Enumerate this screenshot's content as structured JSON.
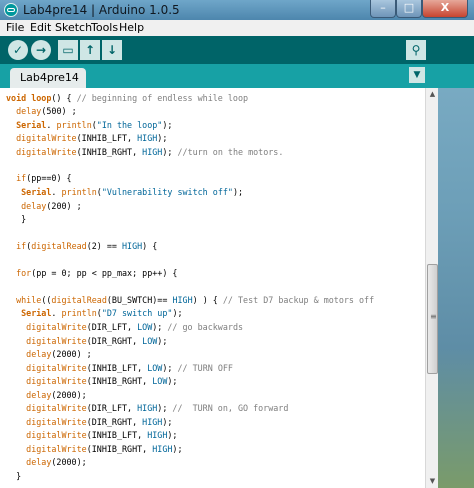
{
  "window": {
    "title": "Lab4pre14 | Arduino 1.0.5",
    "minimize_label": "–",
    "maximize_label": "□",
    "close_label": "X"
  },
  "menu": [
    "File",
    "Edit",
    "Sketch",
    "Tools",
    "Help"
  ],
  "toolbar": {
    "verify_icon": "✓",
    "upload_icon": "→",
    "new_icon": "▭",
    "open_icon": "↑",
    "save_icon": "↓",
    "serial_monitor_icon": "⚲"
  },
  "tab": {
    "label": "Lab4pre14",
    "menu_icon": "▼"
  },
  "scrollbar": {
    "up": "▲",
    "down": "▼",
    "grip": "≡"
  },
  "code": [
    [
      [
        "kwb",
        "void "
      ],
      [
        "kwb",
        "loop"
      ],
      [
        "",
        "() { "
      ],
      [
        "cmt",
        "// beginning of endless while loop"
      ]
    ],
    [
      [
        "",
        "  "
      ],
      [
        "kw",
        "delay"
      ],
      [
        "",
        "(500) ;"
      ]
    ],
    [
      [
        "",
        "  "
      ],
      [
        "kwb",
        "Serial"
      ],
      [
        "",
        ". "
      ],
      [
        "kw",
        "println"
      ],
      [
        "",
        "("
      ],
      [
        "str",
        "\"In the loop\""
      ],
      [
        "",
        ");"
      ]
    ],
    [
      [
        "",
        "  "
      ],
      [
        "kw",
        "digitalWrite"
      ],
      [
        "",
        "(INHIB_LFT, "
      ],
      [
        "lit",
        "HIGH"
      ],
      [
        "",
        ");"
      ]
    ],
    [
      [
        "",
        "  "
      ],
      [
        "kw",
        "digitalWrite"
      ],
      [
        "",
        "(INHIB_RGHT, "
      ],
      [
        "lit",
        "HIGH"
      ],
      [
        "",
        "); "
      ],
      [
        "cmt",
        "//turn on the motors."
      ]
    ],
    [
      [
        "",
        ""
      ]
    ],
    [
      [
        "",
        "  "
      ],
      [
        "kw",
        "if"
      ],
      [
        "",
        "(pp==0) {"
      ]
    ],
    [
      [
        "",
        "   "
      ],
      [
        "kwb",
        "Serial"
      ],
      [
        "",
        ". "
      ],
      [
        "kw",
        "println"
      ],
      [
        "",
        "("
      ],
      [
        "str",
        "\"Vulnerability switch off\""
      ],
      [
        "",
        ");"
      ]
    ],
    [
      [
        "",
        "   "
      ],
      [
        "kw",
        "delay"
      ],
      [
        "",
        "(200) ;"
      ]
    ],
    [
      [
        "",
        "   }"
      ]
    ],
    [
      [
        "",
        ""
      ]
    ],
    [
      [
        "",
        "  "
      ],
      [
        "kw",
        "if"
      ],
      [
        "",
        "("
      ],
      [
        "kw",
        "digitalRead"
      ],
      [
        "",
        "(2) == "
      ],
      [
        "lit",
        "HIGH"
      ],
      [
        "",
        ") {"
      ]
    ],
    [
      [
        "",
        ""
      ]
    ],
    [
      [
        "",
        "  "
      ],
      [
        "kw",
        "for"
      ],
      [
        "",
        "(pp = 0; pp < pp_max; pp++) {"
      ]
    ],
    [
      [
        "",
        ""
      ]
    ],
    [
      [
        "",
        "  "
      ],
      [
        "kw",
        "while"
      ],
      [
        "",
        "(("
      ],
      [
        "kw",
        "digitalRead"
      ],
      [
        "",
        "(BU_SWTCH)== "
      ],
      [
        "lit",
        "HIGH"
      ],
      [
        "",
        ") ) { "
      ],
      [
        "cmt",
        "// Test D7 backup & motors off"
      ]
    ],
    [
      [
        "",
        "   "
      ],
      [
        "kwb",
        "Serial"
      ],
      [
        "",
        ". "
      ],
      [
        "kw",
        "println"
      ],
      [
        "",
        "("
      ],
      [
        "str",
        "\"D7 switch up\""
      ],
      [
        "",
        ");"
      ]
    ],
    [
      [
        "",
        "    "
      ],
      [
        "kw",
        "digitalWrite"
      ],
      [
        "",
        "(DIR_LFT, "
      ],
      [
        "lit",
        "LOW"
      ],
      [
        "",
        "); "
      ],
      [
        "cmt",
        "// go backwards"
      ]
    ],
    [
      [
        "",
        "    "
      ],
      [
        "kw",
        "digitalWrite"
      ],
      [
        "",
        "(DIR_RGHT, "
      ],
      [
        "lit",
        "LOW"
      ],
      [
        "",
        ");"
      ]
    ],
    [
      [
        "",
        "    "
      ],
      [
        "kw",
        "delay"
      ],
      [
        "",
        "(2000) ;"
      ]
    ],
    [
      [
        "",
        "    "
      ],
      [
        "kw",
        "digitalWrite"
      ],
      [
        "",
        "(INHIB_LFT, "
      ],
      [
        "lit",
        "LOW"
      ],
      [
        "",
        "); "
      ],
      [
        "cmt",
        "// TURN OFF"
      ]
    ],
    [
      [
        "",
        "    "
      ],
      [
        "kw",
        "digitalWrite"
      ],
      [
        "",
        "(INHIB_RGHT, "
      ],
      [
        "lit",
        "LOW"
      ],
      [
        "",
        ");"
      ]
    ],
    [
      [
        "",
        "    "
      ],
      [
        "kw",
        "delay"
      ],
      [
        "",
        "(2000);"
      ]
    ],
    [
      [
        "",
        "    "
      ],
      [
        "kw",
        "digitalWrite"
      ],
      [
        "",
        "(DIR_LFT, "
      ],
      [
        "lit",
        "HIGH"
      ],
      [
        "",
        "); "
      ],
      [
        "cmt",
        "//  TURN on, GO forward"
      ]
    ],
    [
      [
        "",
        "    "
      ],
      [
        "kw",
        "digitalWrite"
      ],
      [
        "",
        "(DIR_RGHT, "
      ],
      [
        "lit",
        "HIGH"
      ],
      [
        "",
        ");"
      ]
    ],
    [
      [
        "",
        "    "
      ],
      [
        "kw",
        "digitalWrite"
      ],
      [
        "",
        "(INHIB_LFT, "
      ],
      [
        "lit",
        "HIGH"
      ],
      [
        "",
        ");"
      ]
    ],
    [
      [
        "",
        "    "
      ],
      [
        "kw",
        "digitalWrite"
      ],
      [
        "",
        "(INHIB_RGHT, "
      ],
      [
        "lit",
        "HIGH"
      ],
      [
        "",
        ");"
      ]
    ],
    [
      [
        "",
        "    "
      ],
      [
        "kw",
        "delay"
      ],
      [
        "",
        "(2000);"
      ]
    ],
    [
      [
        "",
        "  }"
      ]
    ]
  ]
}
